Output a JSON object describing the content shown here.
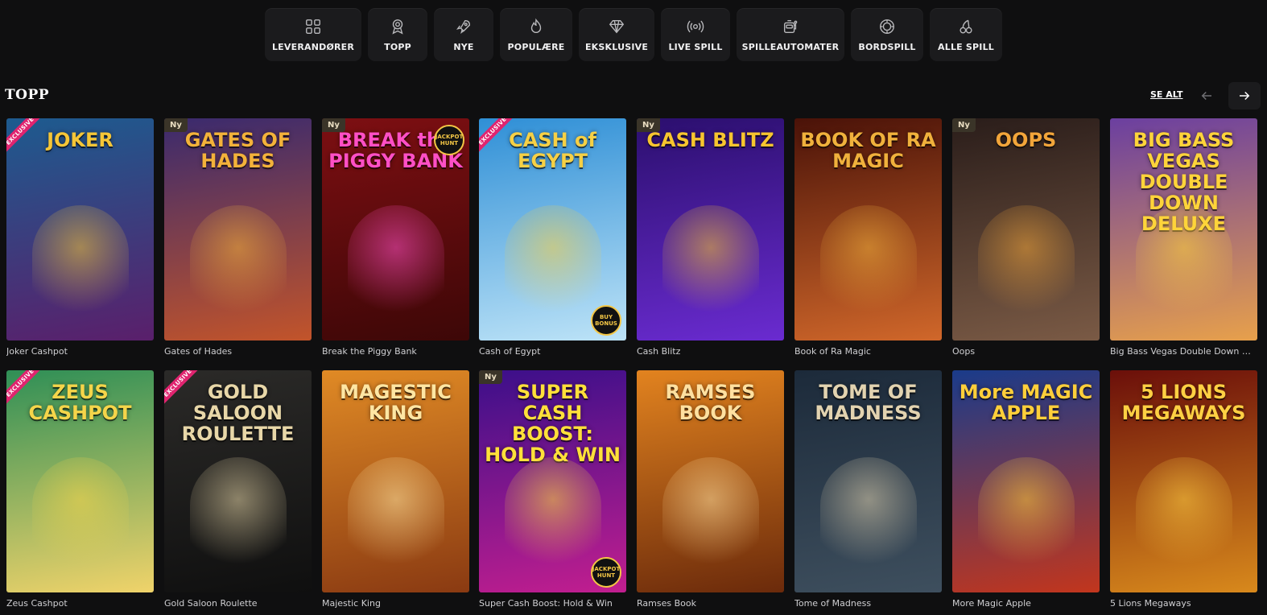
{
  "nav": {
    "items": [
      {
        "label": "LEVERANDØRER",
        "icon": "grid-icon"
      },
      {
        "label": "TOPP",
        "icon": "medal-icon"
      },
      {
        "label": "NYE",
        "icon": "rocket-icon"
      },
      {
        "label": "POPULÆRE",
        "icon": "flame-icon"
      },
      {
        "label": "EKSKLUSIVE",
        "icon": "diamond-icon"
      },
      {
        "label": "LIVE SPILL",
        "icon": "broadcast-icon"
      },
      {
        "label": "SPILLEAUTOMATER",
        "icon": "slot-machine-icon"
      },
      {
        "label": "BORDSPILL",
        "icon": "chip-icon"
      },
      {
        "label": "ALLE SPILL",
        "icon": "cherries-icon"
      }
    ]
  },
  "section": {
    "title": "TOPP",
    "see_all": "SE ALT"
  },
  "badges": {
    "new": "Ny",
    "exclusive": "EXCLUSIVE",
    "jackpot_hunt": "JACKPOT HUNT",
    "buy_bonus": "BUY BONUS"
  },
  "games": [
    {
      "name": "Joker Cashpot",
      "art_title": "JOKER",
      "badge": "exclusive",
      "bg": [
        "#1d5b8f",
        "#5a1f6b"
      ],
      "title_color": "#f5c637"
    },
    {
      "name": "Gates of Hades",
      "art_title": "GATES OF HADES",
      "badge": "new",
      "bg": [
        "#3a2a6e",
        "#c2542a"
      ],
      "title_color": "#f3b23a"
    },
    {
      "name": "Break the Piggy Bank",
      "art_title": "BREAK the PIGGY BANK",
      "badge": "new",
      "corner": "jackpot",
      "bg": [
        "#7d0f12",
        "#3d0707"
      ],
      "title_color": "#ff4fc6"
    },
    {
      "name": "Cash of Egypt",
      "art_title": "CASH of EGYPT",
      "badge": "exclusive",
      "corner": "bonus",
      "bg": [
        "#2f8fd6",
        "#bde3f7"
      ],
      "title_color": "#f6d045"
    },
    {
      "name": "Cash Blitz",
      "art_title": "CASH BLITZ",
      "badge": "new",
      "bg": [
        "#2b0f6e",
        "#6a2bd0"
      ],
      "title_color": "#f7c52f"
    },
    {
      "name": "Book of Ra Magic",
      "art_title": "BOOK OF RA MAGIC",
      "bg": [
        "#4a1208",
        "#d0672a"
      ],
      "title_color": "#f0b13c"
    },
    {
      "name": "Oops",
      "art_title": "OOPS",
      "badge": "new",
      "bg": [
        "#2a1d1a",
        "#7a5a45"
      ],
      "title_color": "#f2a53a"
    },
    {
      "name": "Big Bass Vegas Double Down Deluxe",
      "art_title": "BIG BASS VEGAS DOUBLE DOWN DELUXE",
      "bg": [
        "#6b3fa0",
        "#e7a04b"
      ],
      "title_color": "#ffd43a"
    },
    {
      "name": "Zeus Cashpot",
      "art_title": "ZEUS CASHPOT",
      "badge": "exclusive",
      "bg": [
        "#2f8f56",
        "#f0d36a"
      ],
      "title_color": "#f5d54a"
    },
    {
      "name": "Gold Saloon Roulette",
      "art_title": "GOLD SALOON ROULETTE",
      "badge": "exclusive",
      "bg": [
        "#2b2a28",
        "#0f0f0f"
      ],
      "title_color": "#e8d7a8"
    },
    {
      "name": "Majestic King",
      "art_title": "MAGESTIC KING",
      "bg": [
        "#e08a25",
        "#8a3a12"
      ],
      "title_color": "#ffe6a3"
    },
    {
      "name": "Super Cash Boost: Hold & Win",
      "art_title": "SUPER CASH BOOST: HOLD & WIN",
      "badge": "new",
      "corner": "jackpot",
      "bg": [
        "#3b0f8a",
        "#c21e8f"
      ],
      "title_color": "#ffe03a"
    },
    {
      "name": "Ramses Book",
      "art_title": "RAMSES BOOK",
      "bg": [
        "#e2831f",
        "#6b2a0b"
      ],
      "title_color": "#ffe0a0"
    },
    {
      "name": "Tome of Madness",
      "art_title": "TOME OF MADNESS",
      "bg": [
        "#1c2a3a",
        "#3e4f5e"
      ],
      "title_color": "#e2d3b0"
    },
    {
      "name": "More Magic Apple",
      "art_title": "More MAGIC APPLE",
      "bg": [
        "#1a3b8a",
        "#c2361d"
      ],
      "title_color": "#ffcf3a"
    },
    {
      "name": "5 Lions Megaways",
      "art_title": "5 LIONS MEGAWAYS",
      "bg": [
        "#6b0f0a",
        "#d8891c"
      ],
      "title_color": "#ffd043"
    }
  ]
}
